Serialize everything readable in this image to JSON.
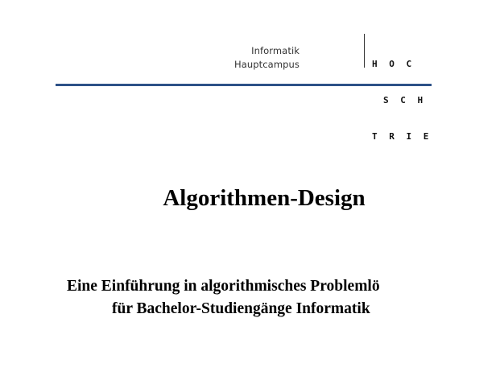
{
  "header": {
    "dept_line1": "Informatik",
    "dept_line2": "Hauptcampus",
    "logo_rows": [
      "H O C",
      "S C H",
      "T R I E"
    ]
  },
  "colors": {
    "rule": "#2d5288"
  },
  "document": {
    "title": "Algorithmen-Design",
    "subtitle_line1": "Eine Einführung in algorithmisches Problemlö",
    "subtitle_line2": "für Bachelor-Studiengänge Informatik"
  }
}
